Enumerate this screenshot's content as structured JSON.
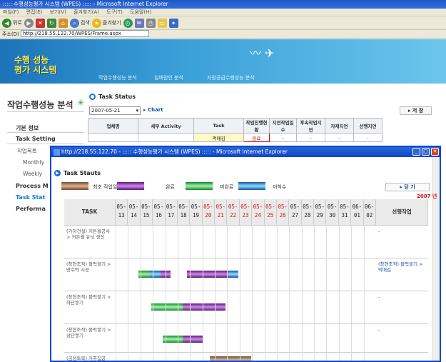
{
  "browser": {
    "title": "::::: 수행성능평가 시스템 (WPES) ::::: - Microsoft Internet Explorer",
    "menu": [
      "파일(F)",
      "편집(E)",
      "보기(V)",
      "즐겨찾기(A)",
      "도구(T)",
      "도움말(H)"
    ],
    "back_label": "뒤로",
    "search_label": "검색",
    "favorites_label": "즐겨찾기",
    "address_label": "주소(D)",
    "address": "http://218.55.122.70/WPES/Frame.aspx"
  },
  "header": {
    "logo_line1": "수행 성능",
    "logo_line2": "평가 시스템",
    "nav": [
      "작업수행성능 분석",
      "실패원인 분석",
      "자원공급수행성능 분석"
    ]
  },
  "sidebar": {
    "title": "작업수행성능 분석",
    "items": [
      "기본 정보",
      "Task Setting",
      "작업목록",
      "Monthly",
      "Weekly",
      "Process M",
      "Task Stat",
      "Performa"
    ]
  },
  "main": {
    "heading": "Task Status",
    "date": "2007-05-21",
    "chart_label": "Chart",
    "save_label": "저 장",
    "columns": [
      "업체명",
      "세부 Activity",
      "Task",
      "작업진행현황",
      "지연작업일수",
      "후속작업지연",
      "자재지연",
      "선행지연"
    ],
    "row": {
      "task": "먹매김",
      "status": "완료",
      "c1": "-",
      "c2": "-",
      "c3": "-",
      "c4": "-"
    }
  },
  "popup": {
    "title": "http://218.55.122.70 - ::::: 수행성능평가 시스템 (WPES) ::::: - Microsoft Internet Explorer",
    "heading": "Task Stauts",
    "legend": [
      "최초 작업일정",
      "완료",
      "미완료",
      "미착수"
    ],
    "close_label": "닫 기",
    "year": "2007 년",
    "task_header": "TASK",
    "prev_header": "선행작업",
    "dates": [
      "05-13",
      "05-14",
      "05-15",
      "05-16",
      "05-17",
      "05-18",
      "05-19",
      "05-20",
      "05-21",
      "05-22",
      "05-23",
      "05-24",
      "05-25",
      "05-26",
      "05-27",
      "05-28",
      "05-29",
      "05-30",
      "05-31",
      "06-01",
      "06-02"
    ],
    "rows": [
      {
        "task": "(가하건설) 커튼월공사 > 커튼월 유닛 생산",
        "prev": "-"
      },
      {
        "task": "(창현조적) 블럭쌓기 > 방수턱 시공",
        "prev": "(창현조적) 블럭쌓기 > 먹매김"
      },
      {
        "task": "(창현조적) 블럭쌓기 > 하단쌓기",
        "prev": "-"
      },
      {
        "task": "(창현조적) 블럭쌓기 > 상단쌓기",
        "prev": "-"
      },
      {
        "task": "(금성토목) 거푸집공",
        "prev": ""
      }
    ]
  },
  "colors": {
    "brown": "#8b5a3c",
    "purple": "#9b3fc0",
    "green": "#1fa84a",
    "blue": "#1a7ac8",
    "accent_red": "#d41010"
  }
}
